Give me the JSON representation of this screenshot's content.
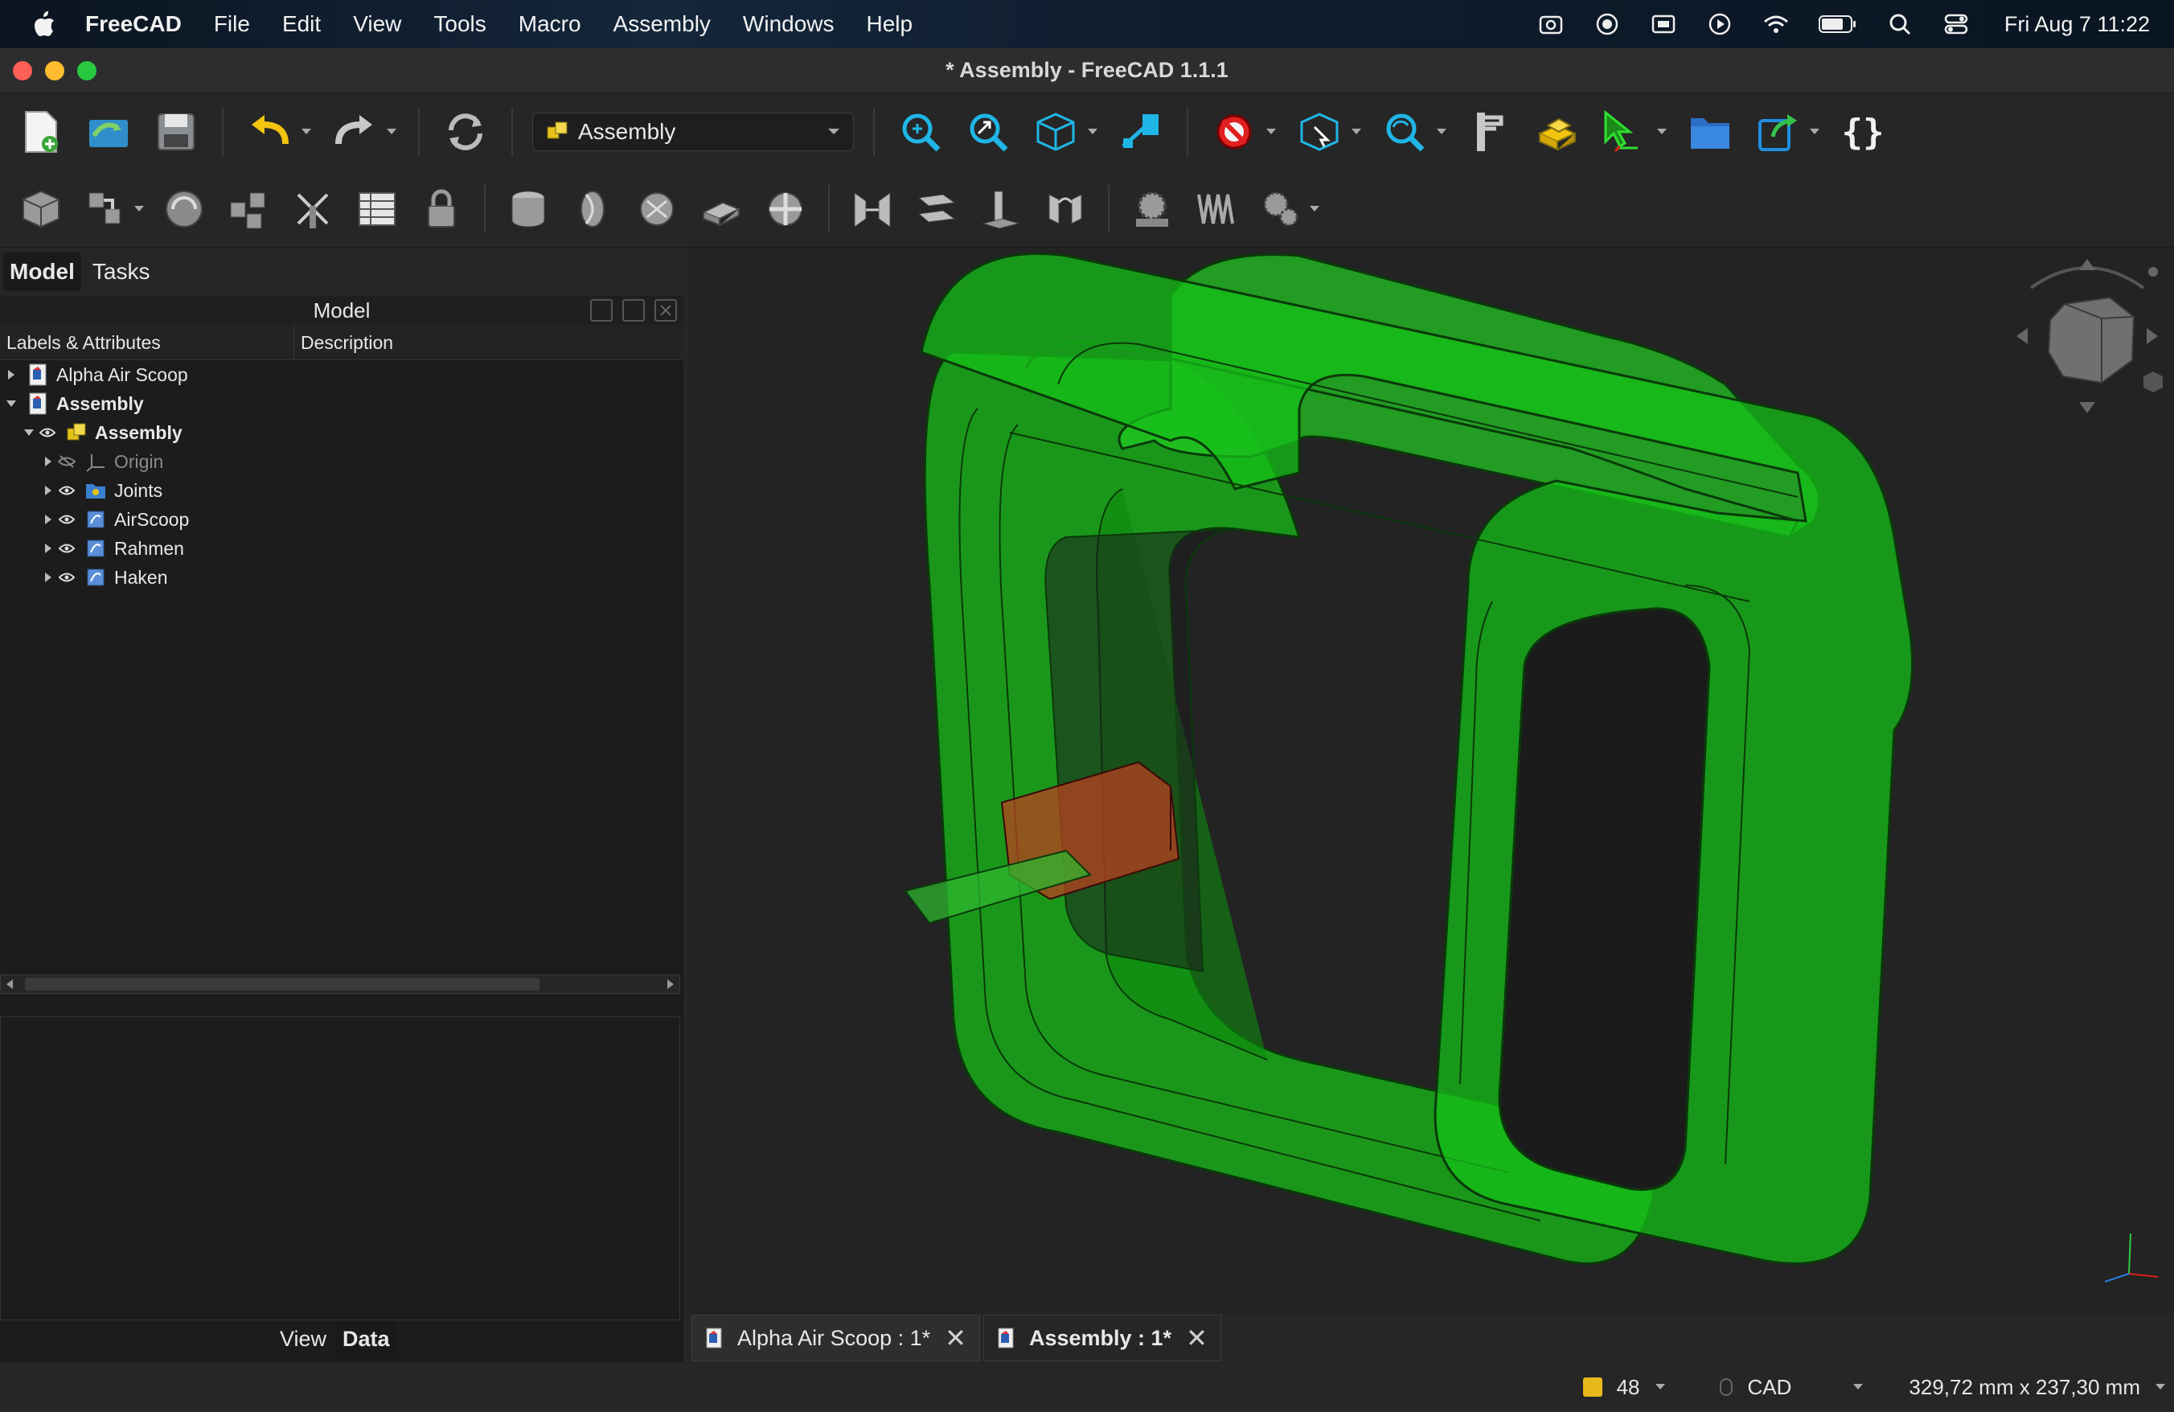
{
  "menubar": {
    "app_name": "FreeCAD",
    "items": [
      "File",
      "Edit",
      "View",
      "Tools",
      "Macro",
      "Assembly",
      "Windows",
      "Help"
    ],
    "clock": "Fri Aug 7  11:22"
  },
  "window": {
    "title": "* Assembly - FreeCAD 1.1.1"
  },
  "toolbar": {
    "workbench": "Assembly"
  },
  "left_panel": {
    "tabs": [
      "Model",
      "Tasks"
    ],
    "header": "Model",
    "columns": [
      "Labels & Attributes",
      "Description"
    ],
    "tree": {
      "doc1": "Alpha Air Scoop",
      "doc2": "Assembly",
      "assembly": "Assembly",
      "origin": "Origin",
      "joints": "Joints",
      "airscoop": "AirScoop",
      "rahmen": "Rahmen",
      "haken": "Haken"
    },
    "bottom_tabs": [
      "View",
      "Data"
    ]
  },
  "view_tabs": [
    {
      "label": "Alpha Air Scoop : 1*"
    },
    {
      "label": "Assembly : 1*"
    }
  ],
  "statusbar": {
    "count": "48",
    "nav_style": "CAD",
    "dimensions": "329,72 mm x 237,30 mm"
  },
  "colors": {
    "model_green": "#18c21a",
    "part_red": "#b8401f",
    "background": "#1b1b1b"
  }
}
